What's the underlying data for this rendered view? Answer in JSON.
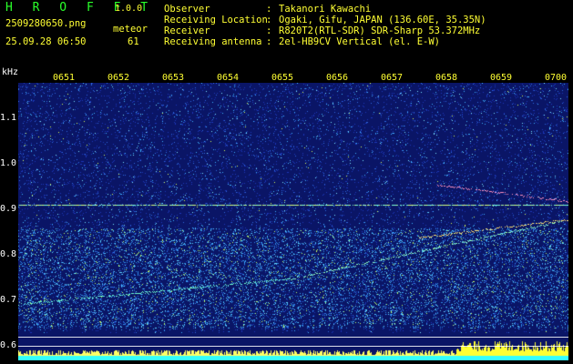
{
  "header": {
    "brand": "H R O F F T",
    "version": "1.0.0",
    "filename": "2509280650.png",
    "meteor_label": "meteor",
    "datetime": "25.09.28 06:50",
    "meteor_count": "61"
  },
  "info": {
    "observer_key": "Observer",
    "observer_val": "Takanori Kawachi",
    "location_key": "Receiving Location",
    "location_val": "Ogaki, Gifu, JAPAN (136.60E, 35.35N)",
    "receiver_key": "Receiver",
    "receiver_val": "R820T2(RTL-SDR) SDR-Sharp 53.372MHz",
    "antenna_key": "Receiving antenna",
    "antenna_val": "2el-HB9CV Vertical (el. E-W)",
    "sep": ":"
  },
  "axis": {
    "unit": "kHz",
    "y_labels": [
      "1.1",
      "1.0",
      "0.9",
      "0.8",
      "0.7",
      "0.6"
    ],
    "time_labels": [
      "0651",
      "0652",
      "0653",
      "0654",
      "0655",
      "0656",
      "0657",
      "0658",
      "0659",
      "0700"
    ]
  },
  "colors": {
    "background": "#000000",
    "plot_bg": "#0a1566",
    "title_green": "#2aff2a",
    "tick_yellow": "#ffff33",
    "noise_bar_cyan": "#33ffff"
  }
}
